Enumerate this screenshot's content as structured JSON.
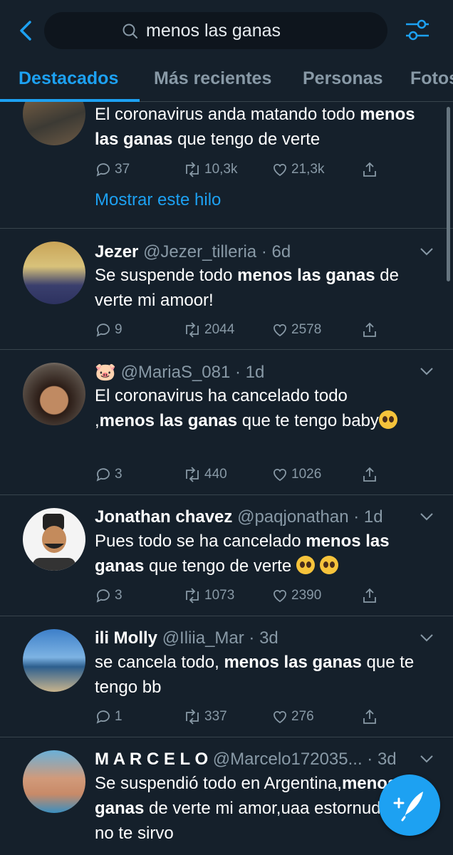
{
  "search": {
    "query": "menos las ganas"
  },
  "tabs": [
    {
      "label": "Destacados",
      "active": true
    },
    {
      "label": "Más recientes",
      "active": false
    },
    {
      "label": "Personas",
      "active": false
    },
    {
      "label": "Fotos",
      "active": false
    }
  ],
  "tweets": [
    {
      "name": "",
      "handle": "",
      "time": "",
      "text_before": "El coronavirus anda matando todo ",
      "text_bold": "menos las ganas",
      "text_after": " que tengo de verte",
      "replies": "37",
      "retweets": "10,3k",
      "likes": "21,3k",
      "thread_link": "Mostrar este hilo"
    },
    {
      "name": "Jezer",
      "handle": "@Jezer_tilleria",
      "time": "6d",
      "text_before": "Se suspende todo ",
      "text_bold": "menos las ganas",
      "text_after": " de verte mi amoor!",
      "replies": "9",
      "retweets": "2044",
      "likes": "2578"
    },
    {
      "name": "🐷",
      "handle": "@MariaS_081",
      "time": "1d",
      "text_before": "El coronavirus  ha cancelado todo ,",
      "text_bold": "menos las ganas",
      "text_after": " que te tengo baby",
      "replies": "3",
      "retweets": "440",
      "likes": "1026"
    },
    {
      "name": "Jonathan chavez",
      "handle": "@paqjonathan",
      "time": "1d",
      "text_before": "Pues todo se ha cancelado ",
      "text_bold": "menos las ganas",
      "text_after": " que tengo de verte ",
      "replies": "3",
      "retweets": "1073",
      "likes": "2390"
    },
    {
      "name": "ili Molly",
      "handle": "@Iliia_Mar",
      "time": "3d",
      "text_before": "se cancela todo, ",
      "text_bold": "menos las ganas",
      "text_after": " que te tengo bb",
      "replies": "1",
      "retweets": "337",
      "likes": "276"
    },
    {
      "name": "M A R C E L O",
      "handle": "@Marcelo172035...",
      "time": "3d",
      "text_before": "Se suspendió todo en Argentina,",
      "text_bold": "menos las ganas",
      "text_after": " de verte mi amor,uaa estornudame si no te sirvo"
    }
  ],
  "colors": {
    "background": "#15202b",
    "accent": "#1da1f2",
    "muted": "#8899a6",
    "divider": "#38444d"
  }
}
